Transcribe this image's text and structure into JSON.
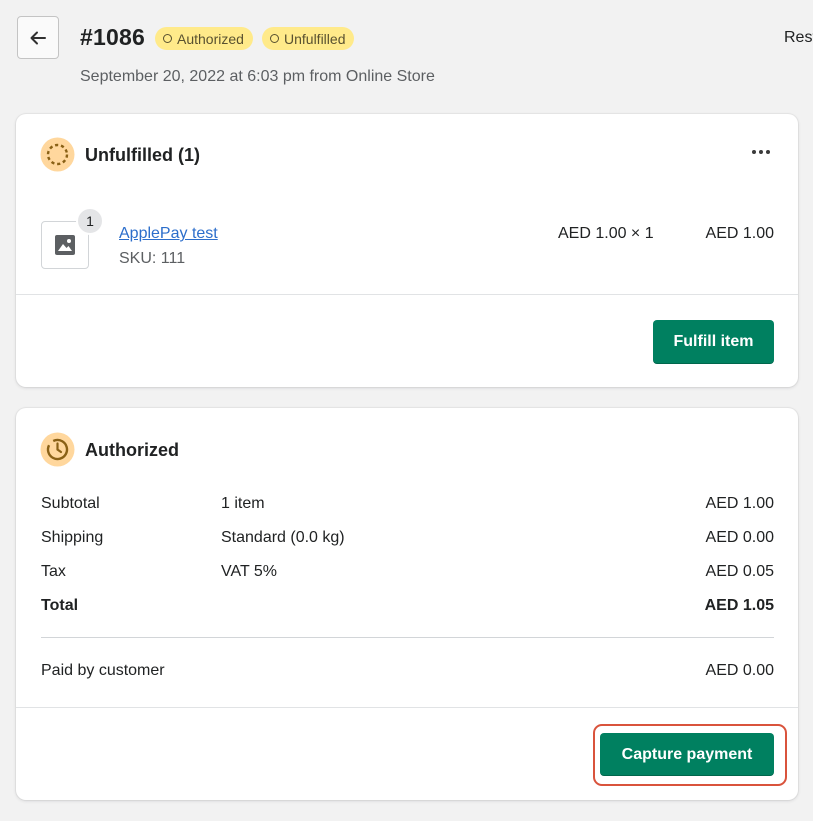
{
  "header": {
    "order_number": "#1086",
    "badges": [
      {
        "label": "Authorized",
        "color": "#ffea8a"
      },
      {
        "label": "Unfulfilled",
        "color": "#ffea8a"
      }
    ],
    "subtitle": "September 20, 2022 at 6:03 pm from Online Store",
    "right_action": "Restock"
  },
  "fulfillment_card": {
    "title": "Unfulfilled (1)",
    "status_color": "#ffc453",
    "more_icon": "horizontal-dots-icon",
    "item": {
      "quantity_badge": "1",
      "image_icon": "image-placeholder-icon",
      "name": "ApplePay test",
      "sku": "SKU: 111",
      "unit_price": "AED 1.00 × 1",
      "total": "AED 1.00"
    },
    "action_label": "Fulfill item"
  },
  "payment_card": {
    "title": "Authorized",
    "status_color": "#ffc453",
    "rows": [
      {
        "label": "Subtotal",
        "desc": "1 item",
        "amount": "AED 1.00"
      },
      {
        "label": "Shipping",
        "desc": "Standard (0.0 kg)",
        "amount": "AED 0.00"
      },
      {
        "label": "Tax",
        "desc": "VAT 5%",
        "amount": "AED 0.05"
      },
      {
        "label": "Total",
        "desc": "",
        "amount": "AED 1.05"
      }
    ],
    "paid": {
      "label": "Paid by customer",
      "amount": "AED 0.00"
    },
    "action_label": "Capture payment"
  },
  "colors": {
    "primary": "#008060",
    "badge": "#ffea8a",
    "highlight": "#d9533c",
    "link": "#2c6ecb"
  }
}
